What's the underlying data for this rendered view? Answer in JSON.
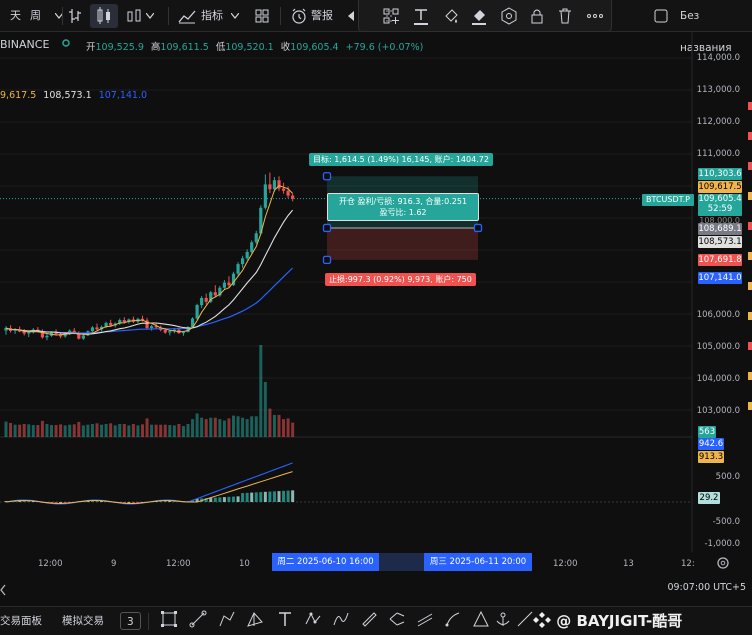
{
  "toolbar": {
    "interval": "天",
    "interval2": "周",
    "indicators": "指标",
    "alert": "警报",
    "layout_name": "Без названия"
  },
  "symbol": {
    "exchange": "BINANCE",
    "open_label": "开",
    "open": "109,525.9",
    "high_label": "高",
    "high": "109,611.5",
    "low_label": "低",
    "low": "109,520.1",
    "close_label": "收",
    "close": "109,605.4",
    "change": "+79.6 (+0.07%)"
  },
  "ma_values": {
    "ma1": "9,617.5",
    "ma2": "108,573.1",
    "ma3": "107,141.0"
  },
  "price_axis": [
    "114,000.0",
    "113,000.0",
    "112,000.0",
    "111,000.0",
    "106,000.0",
    "105,000.0",
    "104,000.0",
    "103,000.0",
    "500.0",
    "-500.0",
    "-1,000.0"
  ],
  "price_tags": {
    "t1": "110,303.6",
    "t2": "109,617.5",
    "symbol_tag": "BTCUSDT.P",
    "t3_price": "109,605.4",
    "t3_timer": "52:59",
    "t4": "108,689.1",
    "t5": "108,573.1",
    "t6": "107,691.8",
    "t7": "107,141.0",
    "v1": "563",
    "m1": "942.6",
    "m2": "913.3",
    "m3": "29.2",
    "gutter_price": "108,000.0"
  },
  "position": {
    "target": "目标: 1,614.5 (1.49%) 16,145, 账户: 1404.72",
    "open_line1": "开仓 盈利/亏损: 916.3, 合量:0.251",
    "open_line2": "盈亏比: 1.62",
    "stop": "止损:997.3 (0.92%) 9,973, 账户: 750"
  },
  "time_axis": {
    "l1": "12:00",
    "l2": "9",
    "l3": "12:00",
    "l4": "10",
    "hl1": "周二 2025-06-10  16:00",
    "hl2": "周三 2025-06-11  20:00",
    "l5": "12:00",
    "l6": "13",
    "l7": "12:"
  },
  "status": {
    "clock": "09:07:00 UTC+5"
  },
  "bottom": {
    "tab1": "交易面板",
    "tab2": "模拟交易",
    "tab3": "3",
    "watermark": "@ BAYJIGIT-酷哥"
  },
  "colors": {
    "up": "#26a69a",
    "down": "#ef5350",
    "ma_blue": "#2962ff",
    "ma_white": "#e0e0e0",
    "ma_orange": "#f0b44c",
    "highlight": "#2962ff"
  },
  "chart_data": {
    "type": "candlestick",
    "candles": [
      [
        105480,
        105620,
        105350,
        105560
      ],
      [
        105560,
        105650,
        105420,
        105470
      ],
      [
        105470,
        105560,
        105380,
        105520
      ],
      [
        105520,
        105610,
        105430,
        105450
      ],
      [
        105450,
        105530,
        105330,
        105390
      ],
      [
        105390,
        105470,
        105280,
        105430
      ],
      [
        105430,
        105560,
        105390,
        105510
      ],
      [
        105510,
        105590,
        105420,
        105460
      ],
      [
        105460,
        105520,
        105230,
        105270
      ],
      [
        105270,
        105380,
        105180,
        105320
      ],
      [
        105320,
        105460,
        105290,
        105420
      ],
      [
        105420,
        105520,
        105350,
        105370
      ],
      [
        105370,
        105430,
        105240,
        105300
      ],
      [
        105300,
        105420,
        105260,
        105390
      ],
      [
        105390,
        105520,
        105340,
        105480
      ],
      [
        105480,
        105560,
        105370,
        105410
      ],
      [
        105410,
        105460,
        105200,
        105230
      ],
      [
        105230,
        105350,
        105190,
        105330
      ],
      [
        105330,
        105490,
        105310,
        105460
      ],
      [
        105460,
        105620,
        105420,
        105580
      ],
      [
        105580,
        105700,
        105480,
        105520
      ],
      [
        105520,
        105640,
        105460,
        105600
      ],
      [
        105600,
        105760,
        105560,
        105720
      ],
      [
        105720,
        105820,
        105600,
        105640
      ],
      [
        105640,
        105740,
        105580,
        105700
      ],
      [
        105700,
        105860,
        105660,
        105810
      ],
      [
        105810,
        105900,
        105700,
        105750
      ],
      [
        105750,
        105860,
        105700,
        105830
      ],
      [
        105830,
        105920,
        105720,
        105760
      ],
      [
        105760,
        105880,
        105720,
        105850
      ],
      [
        105850,
        105950,
        105760,
        105800
      ],
      [
        105800,
        105880,
        105520,
        105560
      ],
      [
        105560,
        105660,
        105480,
        105620
      ],
      [
        105620,
        105700,
        105520,
        105580
      ],
      [
        105580,
        105640,
        105460,
        105500
      ],
      [
        105500,
        105560,
        105380,
        105420
      ],
      [
        105420,
        105500,
        105330,
        105460
      ],
      [
        105460,
        105560,
        105400,
        105510
      ],
      [
        105510,
        105580,
        105380,
        105400
      ],
      [
        105400,
        105460,
        105320,
        105440
      ],
      [
        105440,
        105620,
        105420,
        105590
      ],
      [
        105590,
        105900,
        105560,
        105860
      ],
      [
        105860,
        106320,
        105820,
        106280
      ],
      [
        106280,
        106560,
        106180,
        106500
      ],
      [
        106500,
        106640,
        106300,
        106380
      ],
      [
        106380,
        106720,
        106340,
        106680
      ],
      [
        106680,
        106900,
        106520,
        106580
      ],
      [
        106580,
        106880,
        106540,
        106820
      ],
      [
        106820,
        107060,
        106760,
        106980
      ],
      [
        106980,
        107180,
        106820,
        106900
      ],
      [
        106900,
        107320,
        106880,
        107260
      ],
      [
        107260,
        107620,
        107200,
        107560
      ],
      [
        107560,
        107820,
        107440,
        107740
      ],
      [
        107740,
        108020,
        107680,
        107940
      ],
      [
        107940,
        108300,
        107880,
        108240
      ],
      [
        108240,
        108600,
        108180,
        108520
      ],
      [
        108520,
        109400,
        108480,
        109320
      ],
      [
        109320,
        110360,
        109260,
        110050
      ],
      [
        110050,
        110420,
        109780,
        109900
      ],
      [
        109900,
        110280,
        109820,
        110180
      ],
      [
        110180,
        110300,
        109840,
        109920
      ],
      [
        109920,
        110100,
        109760,
        109850
      ],
      [
        109850,
        109980,
        109620,
        109700
      ],
      [
        109700,
        109760,
        109520,
        109605
      ]
    ]
  }
}
